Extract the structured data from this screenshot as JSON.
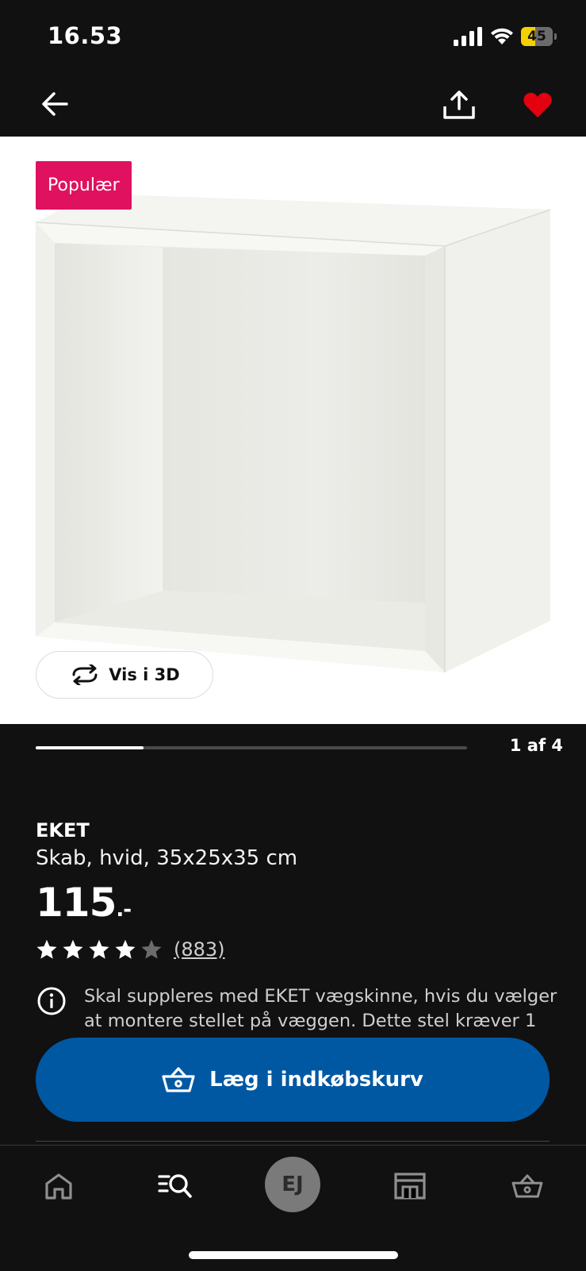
{
  "status_bar": {
    "time": "16.53",
    "battery": "45",
    "battery_fraction": 0.45
  },
  "nav": {
    "back_icon": "arrow-left-icon",
    "share_icon": "share-icon",
    "favorite_icon": "heart-icon",
    "favorite_color": "#e3000f"
  },
  "product": {
    "badge": "Populær",
    "badge_color": "#e0115f",
    "view_3d_label": "Vis i 3D",
    "carousel": {
      "current": 1,
      "total": 4,
      "counter": "1 af 4"
    },
    "name": "EKET",
    "description": "Skab, hvid, 35x25x35 cm",
    "price": "115",
    "price_suffix": ".-",
    "rating": {
      "stars": 4,
      "max": 5,
      "review_count": "(883)"
    },
    "info_text": "Skal suppleres med EKET vægskinne, hvis du vælger at montere stellet på væggen. Dette stel kræver 1"
  },
  "cart_button": {
    "label": "Læg i indkøbskurv",
    "color": "#0058a3"
  },
  "tab_bar": {
    "profile_initials": "EJ",
    "icons": [
      "home-icon",
      "search-icon",
      "profile-avatar",
      "store-icon",
      "basket-icon"
    ]
  }
}
